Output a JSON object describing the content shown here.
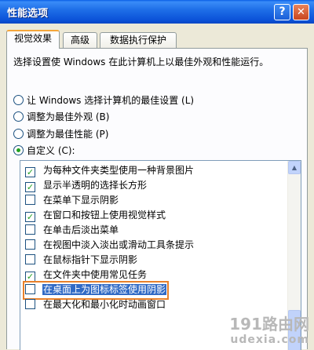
{
  "window": {
    "title": "性能选项",
    "help_glyph": "?",
    "close_glyph": "✕"
  },
  "tabs": [
    {
      "label": "视觉效果",
      "active": true
    },
    {
      "label": "高级",
      "active": false
    },
    {
      "label": "数据执行保护",
      "active": false
    }
  ],
  "description": "选择设置使 Windows 在此计算机上以最佳外观和性能运行。",
  "radios": [
    {
      "label": "让 Windows 选择计算机的最佳设置 (L)",
      "checked": false
    },
    {
      "label": "调整为最佳外观 (B)",
      "checked": false
    },
    {
      "label": "调整为最佳性能 (P)",
      "checked": false
    },
    {
      "label": "自定义 (C):",
      "checked": true
    }
  ],
  "effects": [
    {
      "label": "为每种文件夹类型使用一种背景图片",
      "checked": true
    },
    {
      "label": "显示半透明的选择长方形",
      "checked": true
    },
    {
      "label": "在菜单下显示阴影",
      "checked": false
    },
    {
      "label": "在窗口和按钮上使用视觉样式",
      "checked": true
    },
    {
      "label": "在单击后淡出菜单",
      "checked": false
    },
    {
      "label": "在视图中淡入淡出或滑动工具条提示",
      "checked": false
    },
    {
      "label": "在鼠标指针下显示阴影",
      "checked": false
    },
    {
      "label": "在文件夹中使用常见任务",
      "checked": true
    },
    {
      "label": "在桌面上为图标标签使用阴影",
      "checked": false,
      "highlighted": true
    },
    {
      "label": "在最大化和最小化时动画窗口",
      "checked": false
    }
  ],
  "watermark": {
    "line1": "191路由网",
    "line2": "udexia.com"
  },
  "colors": {
    "title_bar": "#1f6fe8",
    "highlight_outline": "#e8812b",
    "selection": "#316ac5",
    "check": "#21a121"
  }
}
